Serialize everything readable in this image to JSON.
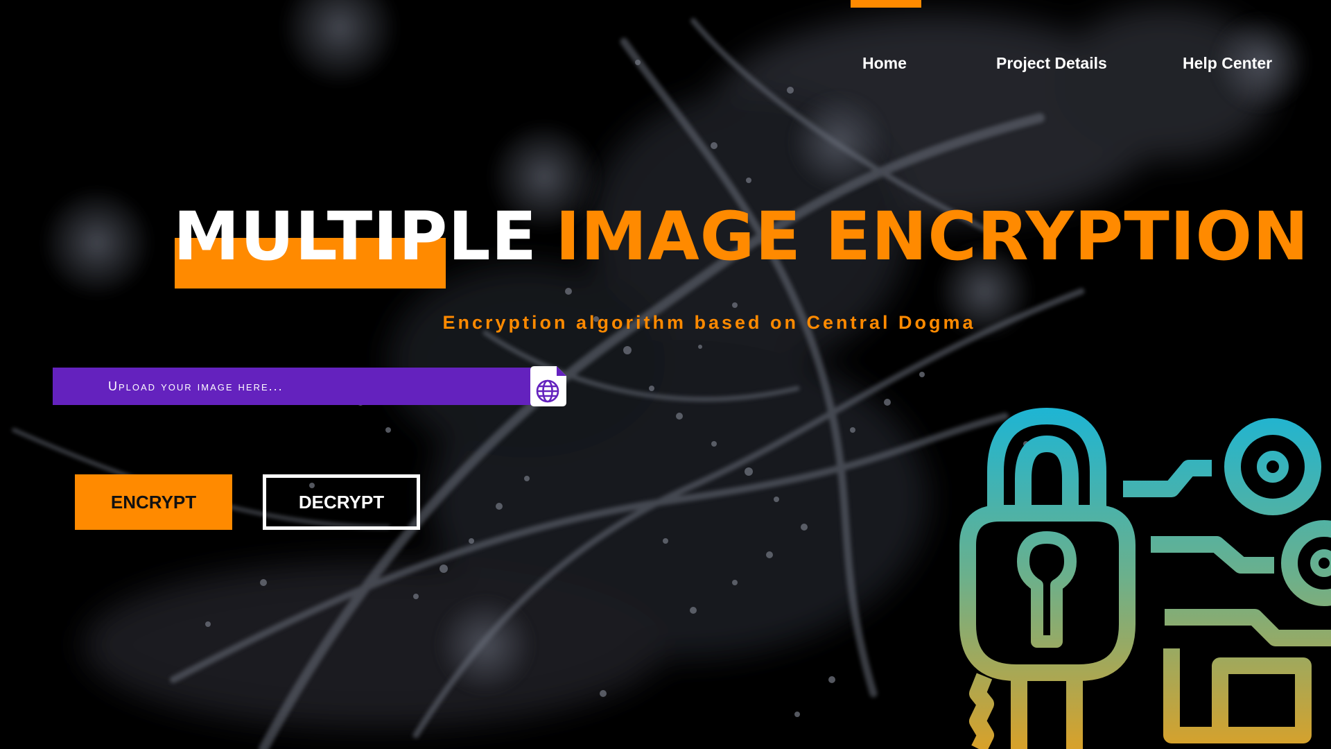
{
  "nav": {
    "items": [
      {
        "label": "Home"
      },
      {
        "label": "Project Details"
      },
      {
        "label": "Help Center"
      }
    ]
  },
  "hero": {
    "title_part1": "MULTIPLE",
    "title_part2": "IMAGE ENCRYPTION",
    "subtitle": "Encryption algorithm based on Central Dogma"
  },
  "upload": {
    "placeholder": "Upload your image here...",
    "icon": "file-globe-icon"
  },
  "actions": {
    "encrypt_label": "ENCRYPT",
    "decrypt_label": "DECRYPT"
  },
  "colors": {
    "accent": "#FF8A00",
    "upload_bar": "#6422BE",
    "background": "#000000",
    "lock_gradient_top": "#1BB5D6",
    "lock_gradient_bottom": "#D8A12A"
  },
  "illustration": {
    "icon": "padlock-circuit-icon"
  }
}
